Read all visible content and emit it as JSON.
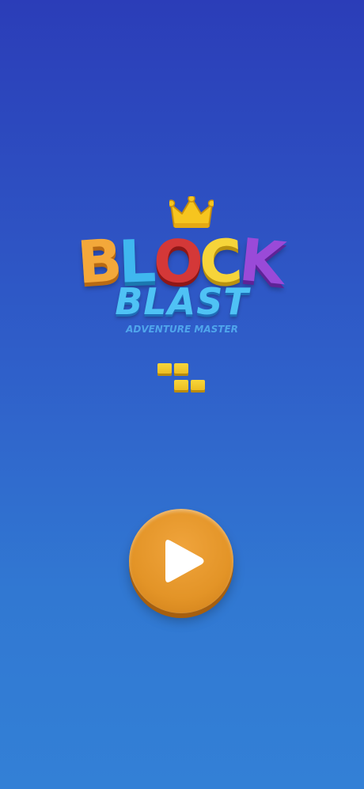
{
  "logo": {
    "letters": [
      "B",
      "L",
      "O",
      "C",
      "K"
    ],
    "subtitle": "BLAST",
    "tagline": "ADVENTURE MASTER"
  },
  "icons": {
    "crown": "crown-icon",
    "loader": "loading-blocks-icon",
    "play": "play-icon"
  },
  "colors": {
    "background_top": "#2b3db8",
    "background_bottom": "#3380d6",
    "play_button": "#e39427",
    "loader_block": "#f3c92a"
  }
}
